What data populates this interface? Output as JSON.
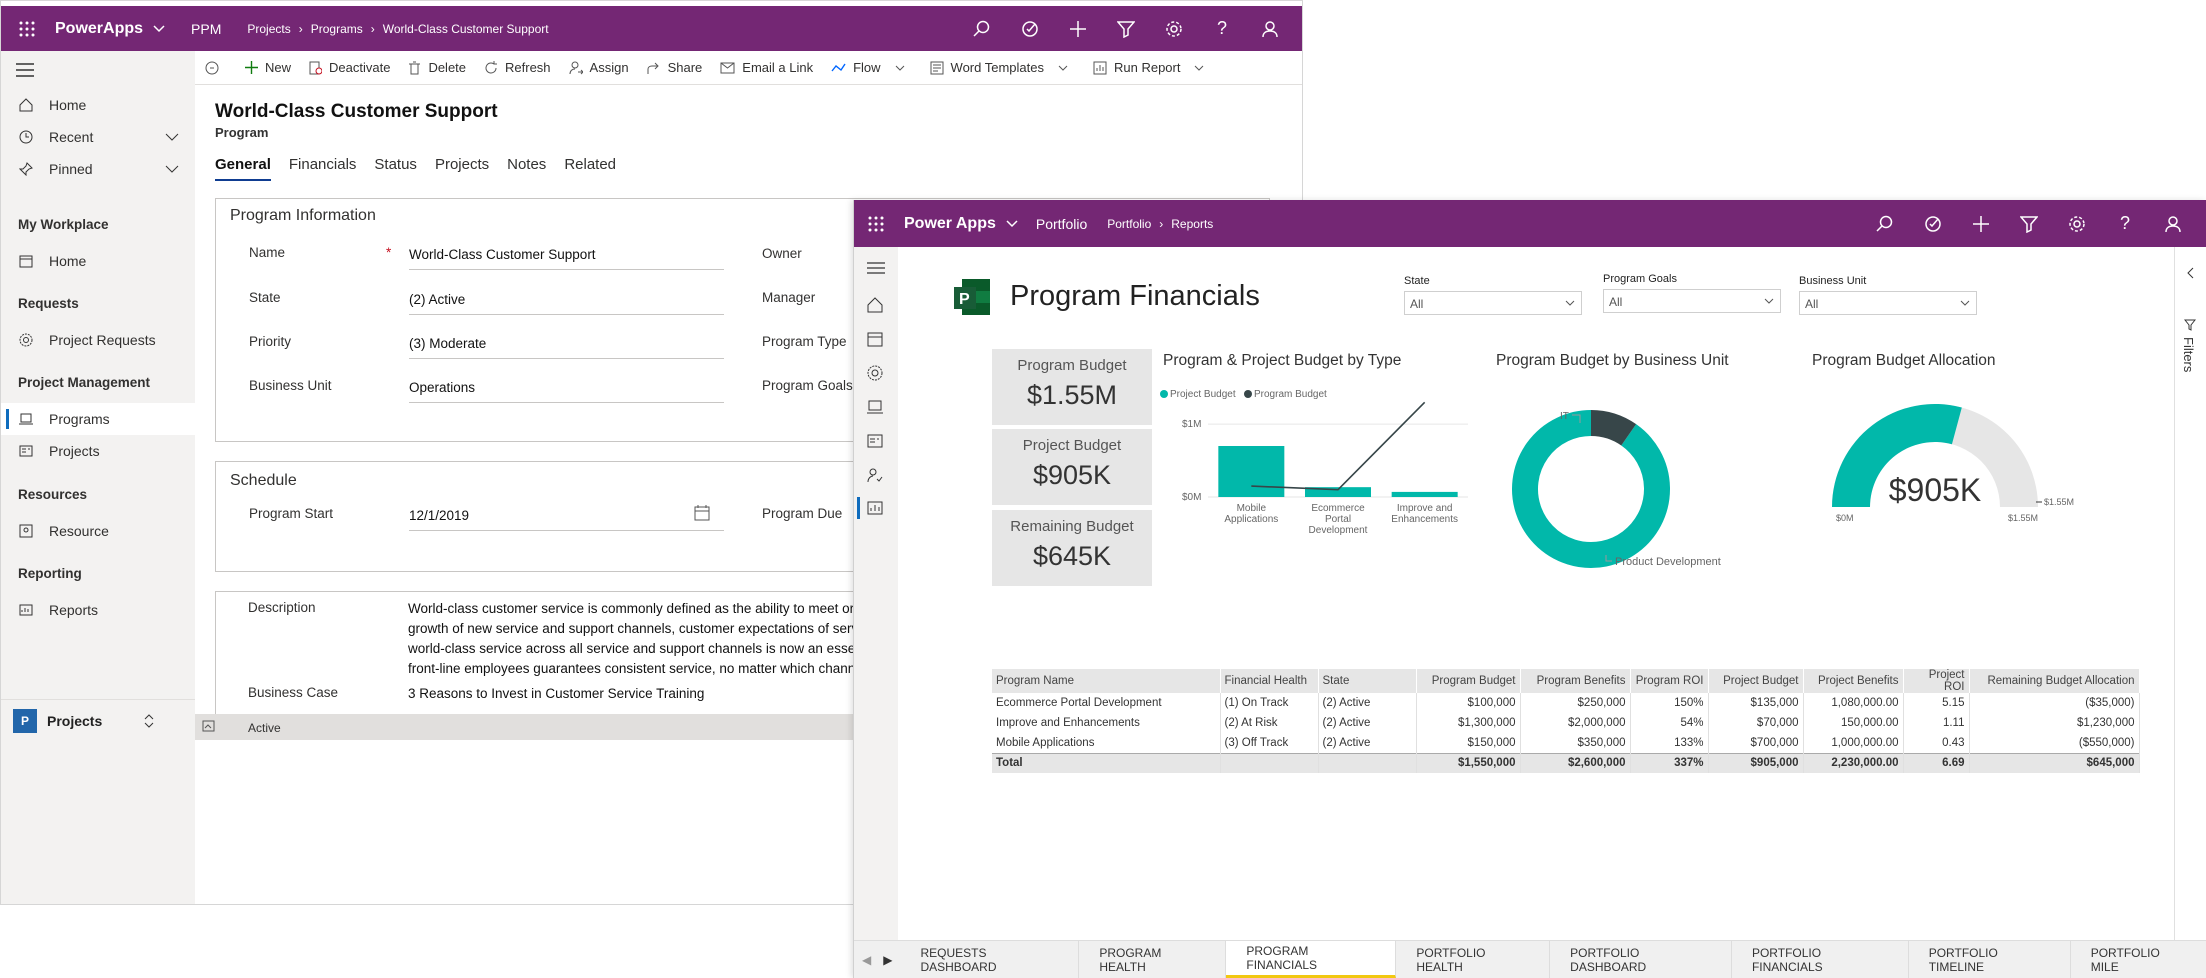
{
  "w1": {
    "app_name": "PowerApps",
    "area": "PPM",
    "breadcrumb": [
      "Projects",
      "Programs",
      "World-Class Customer Support"
    ],
    "sidebar": {
      "top_items": [
        {
          "label": "Home",
          "icon": "home-icon"
        },
        {
          "label": "Recent",
          "icon": "clock-icon"
        },
        {
          "label": "Pinned",
          "icon": "pin-icon"
        }
      ],
      "sections": [
        {
          "title": "My Workplace",
          "items": [
            {
              "label": "Home",
              "icon": "calendar-icon"
            }
          ]
        },
        {
          "title": "Requests",
          "items": [
            {
              "label": "Project Requests",
              "icon": "badge-icon"
            }
          ]
        },
        {
          "title": "Project Management",
          "items": [
            {
              "label": "Programs",
              "icon": "laptop-icon"
            },
            {
              "label": "Projects",
              "icon": "card-icon"
            }
          ]
        },
        {
          "title": "Resources",
          "items": [
            {
              "label": "Resource",
              "icon": "resource-icon"
            }
          ]
        },
        {
          "title": "Reporting",
          "items": [
            {
              "label": "Reports",
              "icon": "report-icon"
            }
          ]
        }
      ],
      "area_switcher": {
        "badge": "P",
        "label": "Projects"
      }
    },
    "commands": [
      "New",
      "Deactivate",
      "Delete",
      "Refresh",
      "Assign",
      "Share",
      "Email a Link",
      "Flow",
      "Word Templates",
      "Run Report"
    ],
    "record": {
      "title": "World-Class Customer Support",
      "entity": "Program"
    },
    "tabs": [
      "General",
      "Financials",
      "Status",
      "Projects",
      "Notes",
      "Related"
    ],
    "program_info": {
      "title": "Program Information",
      "fields": [
        {
          "label": "Name",
          "value": "World-Class Customer Support",
          "required": "*"
        },
        {
          "label": "State",
          "value": "(2) Active"
        },
        {
          "label": "Priority",
          "value": "(3) Moderate"
        },
        {
          "label": "Business Unit",
          "value": "Operations"
        }
      ],
      "right_fields": [
        "Owner",
        "Manager",
        "Program Type",
        "Program Goals"
      ]
    },
    "schedule": {
      "title": "Schedule",
      "start_label": "Program Start",
      "start_value": "12/1/2019",
      "due_label": "Program Due"
    },
    "description": {
      "label": "Description",
      "lines": [
        "World-class customer service is commonly defined as the ability to meet or e",
        "growth of new service and support channels, customer expectations of servi",
        "world-class service across all service and support channels is now an essenti",
        "front-line employees guarantees consistent service, no matter which channe"
      ]
    },
    "business_case": {
      "label": "Business Case",
      "value": "3 Reasons to Invest in Customer Service Training"
    },
    "status": "Active"
  },
  "w2": {
    "app_name": "Power Apps",
    "area": "Portfolio",
    "breadcrumb": [
      "Portfolio",
      "Reports"
    ],
    "report_title": "Program Financials",
    "slicers": [
      {
        "label": "State",
        "value": "All"
      },
      {
        "label": "Program Goals",
        "value": "All"
      },
      {
        "label": "Business Unit",
        "value": "All"
      }
    ],
    "kpis": [
      {
        "label": "Program Budget",
        "value": "$1.55M"
      },
      {
        "label": "Project Budget",
        "value": "$905K"
      },
      {
        "label": "Remaining Budget",
        "value": "$645K"
      }
    ],
    "filters_label": "Filters",
    "page_tabs": [
      "REQUESTS DASHBOARD",
      "PROGRAM HEALTH",
      "PROGRAM FINANCIALS",
      "PORTFOLIO HEALTH",
      "PORTFOLIO DASHBOARD",
      "PORTFOLIO FINANCIALS",
      "PORTFOLIO TIMELINE",
      "PORTFOLIO MILE"
    ],
    "active_page": "PROGRAM FINANCIALS",
    "table": {
      "columns": [
        "Program Name",
        "Financial Health",
        "State",
        "Program Budget",
        "Program Benefits",
        "Program ROI",
        "Project Budget",
        "Project Benefits",
        "Project ROI",
        "Remaining Budget Allocation"
      ],
      "rows": [
        [
          "Ecommerce Portal Development",
          "(1) On Track",
          "(2) Active",
          "$100,000",
          "$250,000",
          "150%",
          "$135,000",
          "1,080,000.00",
          "5.15",
          "($35,000)"
        ],
        [
          "Improve and Enhancements",
          "(2) At Risk",
          "(2) Active",
          "$1,300,000",
          "$2,000,000",
          "54%",
          "$70,000",
          "150,000.00",
          "1.11",
          "$1,230,000"
        ],
        [
          "Mobile Applications",
          "(3) Off Track",
          "(2) Active",
          "$150,000",
          "$350,000",
          "133%",
          "$700,000",
          "1,000,000.00",
          "0.43",
          "($550,000)"
        ]
      ],
      "total": [
        "Total",
        "",
        "",
        "$1,550,000",
        "$2,600,000",
        "337%",
        "$905,000",
        "2,230,000.00",
        "6.69",
        "$645,000"
      ]
    }
  },
  "colors": {
    "brand": "#742774",
    "teal": "#01b8aa",
    "dark": "#374649",
    "gauge_bg": "#e6e6e6"
  },
  "chart_data": [
    {
      "type": "bar",
      "title": "Program & Project Budget by Type",
      "legend": [
        "Project Budget",
        "Program Budget"
      ],
      "categories": [
        "Mobile Applications",
        "Ecommerce Portal Development",
        "Improve and Enhancements"
      ],
      "category_lines": [
        [
          "Mobile",
          "Applications"
        ],
        [
          "Ecommerce",
          "Portal",
          "Development"
        ],
        [
          "Improve and",
          "Enhancements"
        ]
      ],
      "series": [
        {
          "name": "Project Budget",
          "kind": "bar",
          "values": [
            700000,
            135000,
            70000
          ]
        },
        {
          "name": "Program Budget",
          "kind": "line",
          "values": [
            150000,
            100000,
            1300000
          ]
        }
      ],
      "yticks": [
        {
          "v": 0,
          "label": "$0M"
        },
        {
          "v": 1000000,
          "label": "$1M"
        }
      ],
      "ylim": [
        0,
        1400000
      ],
      "legend_position": "top-left"
    },
    {
      "type": "pie",
      "title": "Program Budget by Business Unit",
      "labels": [
        "Product Development",
        "IT"
      ],
      "values": [
        1400000,
        150000
      ],
      "donut": true
    },
    {
      "type": "gauge",
      "title": "Program Budget Allocation",
      "value": 905000,
      "value_label": "$905K",
      "min": 0,
      "min_label": "$0M",
      "max": 1550000,
      "max_label": "$1.55M",
      "target_label": "$1.55M"
    }
  ]
}
